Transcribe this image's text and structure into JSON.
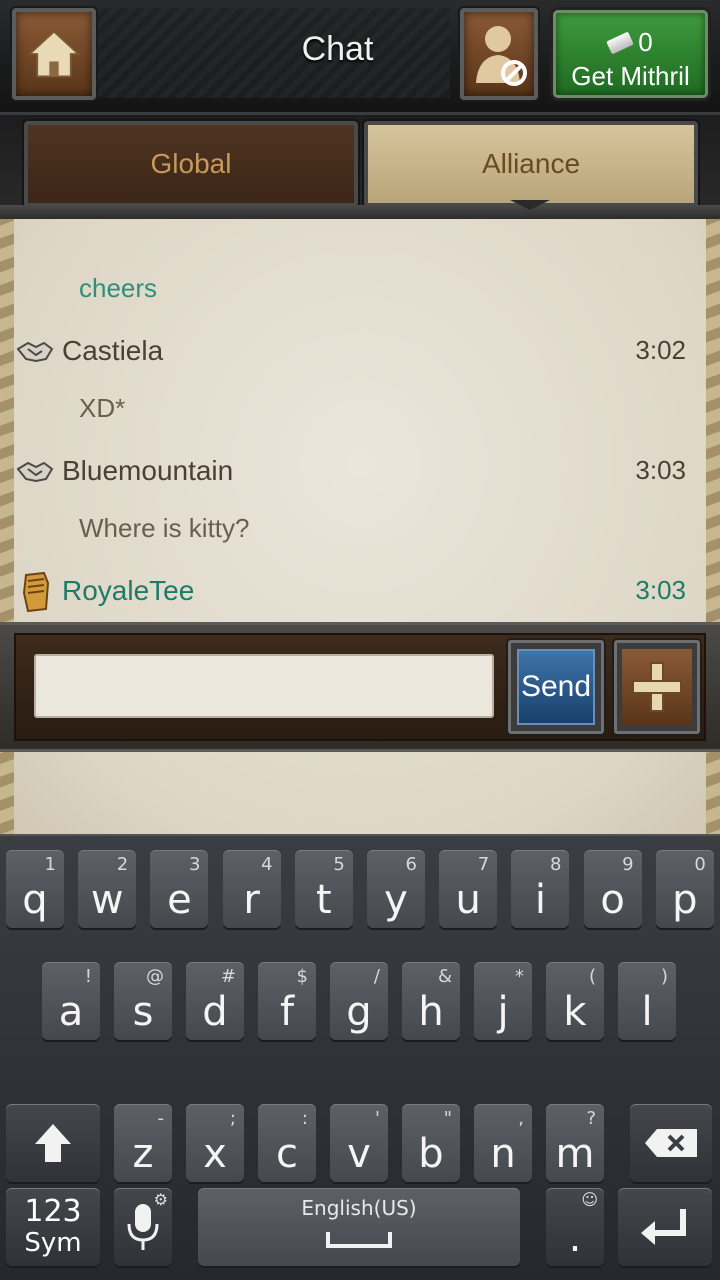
{
  "header": {
    "title": "Chat",
    "mithril_count": "0",
    "mithril_label": "Get Mithril"
  },
  "tabs": [
    {
      "label": "Global",
      "selected": false
    },
    {
      "label": "Alliance",
      "selected": true
    }
  ],
  "messages": {
    "cheers": "cheers",
    "castiela_name": "Castiela",
    "castiela_time": "3:02",
    "castiela_text": "XD*",
    "blue_name": "Bluemountain",
    "blue_time": "3:03",
    "blue_text": "Where is kitty?",
    "royale_name": "RoyaleTee",
    "royale_time": "3:03"
  },
  "input": {
    "value": "",
    "send_label": "Send"
  },
  "keyboard": {
    "row1": [
      {
        "k": "q",
        "s": "1"
      },
      {
        "k": "w",
        "s": "2"
      },
      {
        "k": "e",
        "s": "3"
      },
      {
        "k": "r",
        "s": "4"
      },
      {
        "k": "t",
        "s": "5"
      },
      {
        "k": "y",
        "s": "6"
      },
      {
        "k": "u",
        "s": "7"
      },
      {
        "k": "i",
        "s": "8"
      },
      {
        "k": "o",
        "s": "9"
      },
      {
        "k": "p",
        "s": "0"
      }
    ],
    "row2": [
      {
        "k": "a",
        "s": "!"
      },
      {
        "k": "s",
        "s": "@"
      },
      {
        "k": "d",
        "s": "#"
      },
      {
        "k": "f",
        "s": "$"
      },
      {
        "k": "g",
        "s": "/"
      },
      {
        "k": "h",
        "s": "&"
      },
      {
        "k": "j",
        "s": "*"
      },
      {
        "k": "k",
        "s": "("
      },
      {
        "k": "l",
        "s": ")"
      }
    ],
    "row3": [
      {
        "k": "z",
        "s": "-"
      },
      {
        "k": "x",
        "s": ";"
      },
      {
        "k": "c",
        "s": ":"
      },
      {
        "k": "v",
        "s": "'"
      },
      {
        "k": "b",
        "s": "\""
      },
      {
        "k": "n",
        "s": ","
      },
      {
        "k": "m",
        "s": "?"
      }
    ],
    "sym_top": "123",
    "sym_bottom": "Sym",
    "space_label": "English(US)",
    "period": "."
  },
  "colors": {
    "teal": "#1f7a68",
    "brown_tab": "#4f3422",
    "tan_tab": "#d6c49c",
    "green_button": "#3e9b3c",
    "send_blue": "#3f74a9"
  }
}
